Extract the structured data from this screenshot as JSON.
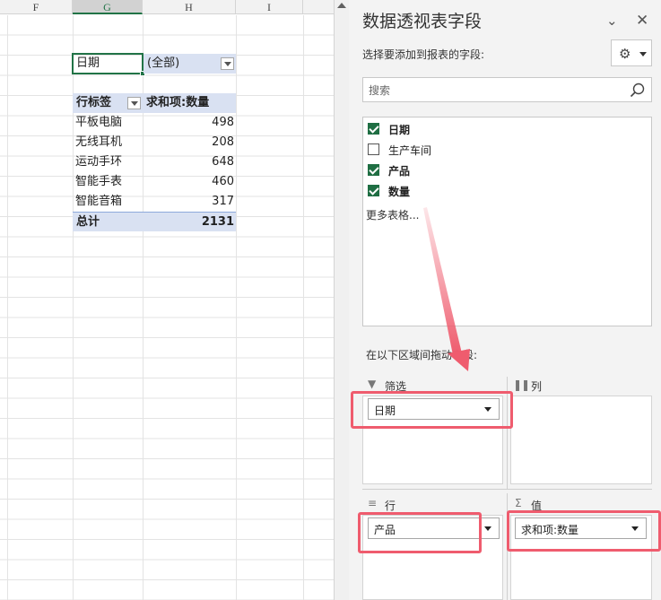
{
  "sheet": {
    "columns": [
      "F",
      "G",
      "H",
      "I"
    ],
    "selected_column": "G",
    "filter_field": "日期",
    "filter_value": "(全部)",
    "pivot": {
      "header_row_label": "行标签",
      "header_value_label": "求和项:数量",
      "rows": [
        {
          "label": "平板电脑",
          "value": "498"
        },
        {
          "label": "无线耳机",
          "value": "208"
        },
        {
          "label": "运动手环",
          "value": "648"
        },
        {
          "label": "智能手表",
          "value": "460"
        },
        {
          "label": "智能音箱",
          "value": "317"
        }
      ],
      "total_label": "总计",
      "total_value": "2131"
    }
  },
  "pane": {
    "title": "数据透视表字段",
    "choose_fields_label": "选择要添加到报表的字段:",
    "search_placeholder": "搜索",
    "fields": [
      {
        "label": "日期",
        "checked": true
      },
      {
        "label": "生产车间",
        "checked": false
      },
      {
        "label": "产品",
        "checked": true
      },
      {
        "label": "数量",
        "checked": true
      }
    ],
    "more_tables": "更多表格...",
    "drag_hint": "在以下区域间拖动字段:",
    "areas": {
      "filters_label": "筛选",
      "columns_label": "列",
      "rows_label": "行",
      "values_label": "值",
      "filter_chip": "日期",
      "row_chip": "产品",
      "value_chip": "求和项:数量"
    }
  },
  "colors": {
    "accent_green": "#217346",
    "pivot_header_fill": "#d9e1f2",
    "highlight_red": "#ef5c6e"
  }
}
